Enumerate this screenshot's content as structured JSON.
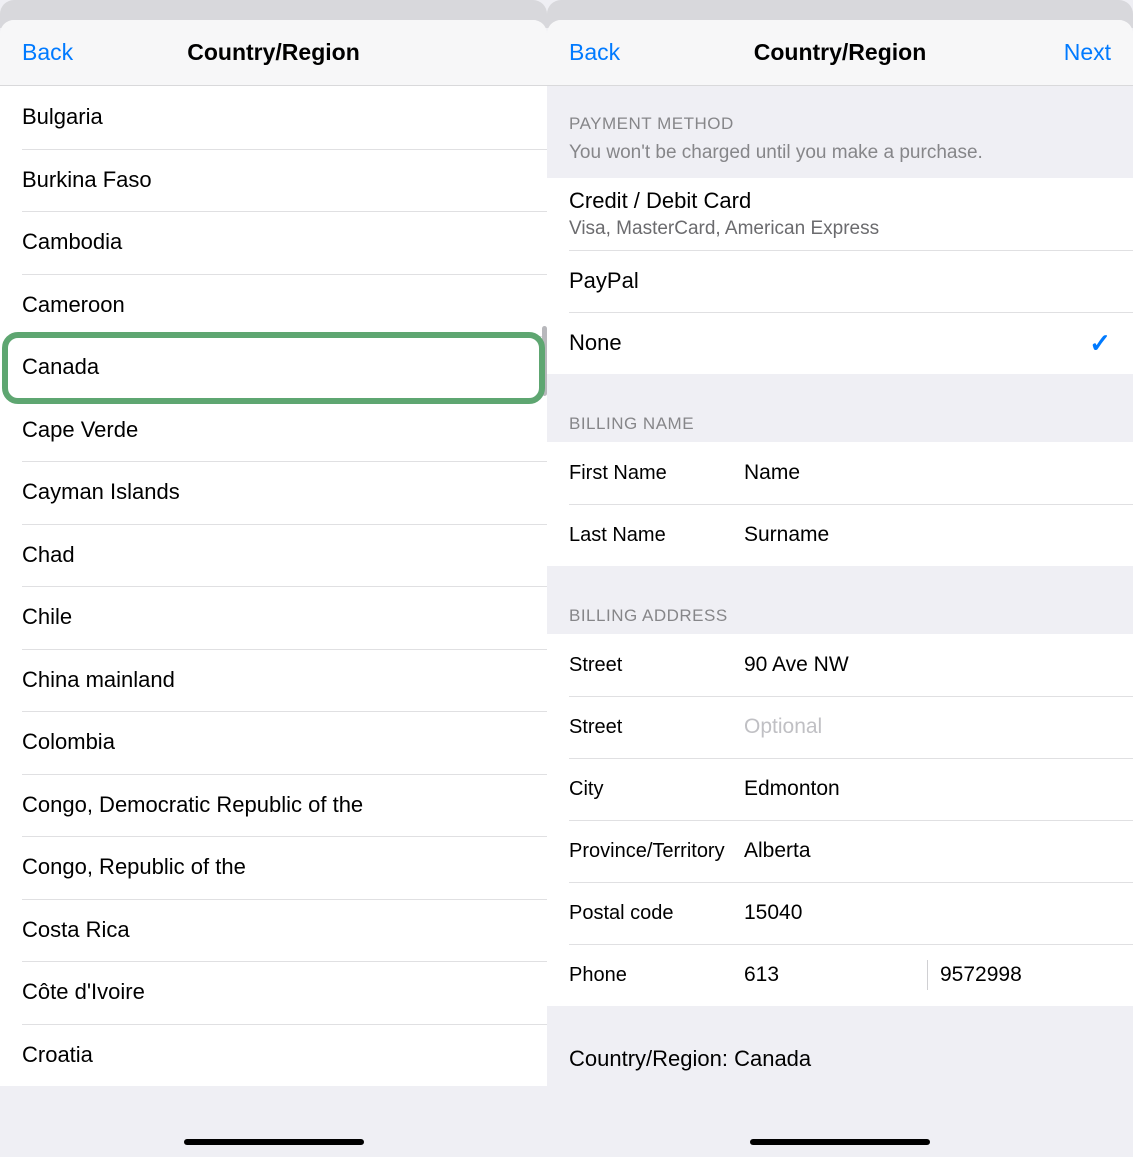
{
  "left": {
    "back": "Back",
    "title": "Country/Region",
    "countries": [
      "Bulgaria",
      "Burkina Faso",
      "Cambodia",
      "Cameroon",
      "Canada",
      "Cape Verde",
      "Cayman Islands",
      "Chad",
      "Chile",
      "China mainland",
      "Colombia",
      "Congo, Democratic Republic of the",
      "Congo, Republic of the",
      "Costa Rica",
      "Côte d'Ivoire",
      "Croatia"
    ],
    "highlighted": "Canada"
  },
  "right": {
    "back": "Back",
    "title": "Country/Region",
    "next": "Next",
    "payment": {
      "header": "PAYMENT METHOD",
      "sub": "You won't be charged until you make a purchase.",
      "options": [
        {
          "label": "Credit / Debit Card",
          "sub": "Visa, MasterCard, American Express",
          "selected": false
        },
        {
          "label": "PayPal",
          "sub": "",
          "selected": false
        },
        {
          "label": "None",
          "sub": "",
          "selected": true
        }
      ]
    },
    "billing_name": {
      "header": "BILLING NAME",
      "first_label": "First Name",
      "first_value": "Name",
      "last_label": "Last Name",
      "last_value": "Surname"
    },
    "billing_address": {
      "header": "BILLING ADDRESS",
      "street_label": "Street",
      "street_value": "90 Ave NW",
      "street2_label": "Street",
      "street2_placeholder": "Optional",
      "city_label": "City",
      "city_value": "Edmonton",
      "province_label": "Province/Territory",
      "province_value": "Alberta",
      "postal_label": "Postal code",
      "postal_value": "15040",
      "phone_label": "Phone",
      "phone_cc": "613",
      "phone_number": "9572998"
    },
    "footer": "Country/Region: Canada"
  }
}
